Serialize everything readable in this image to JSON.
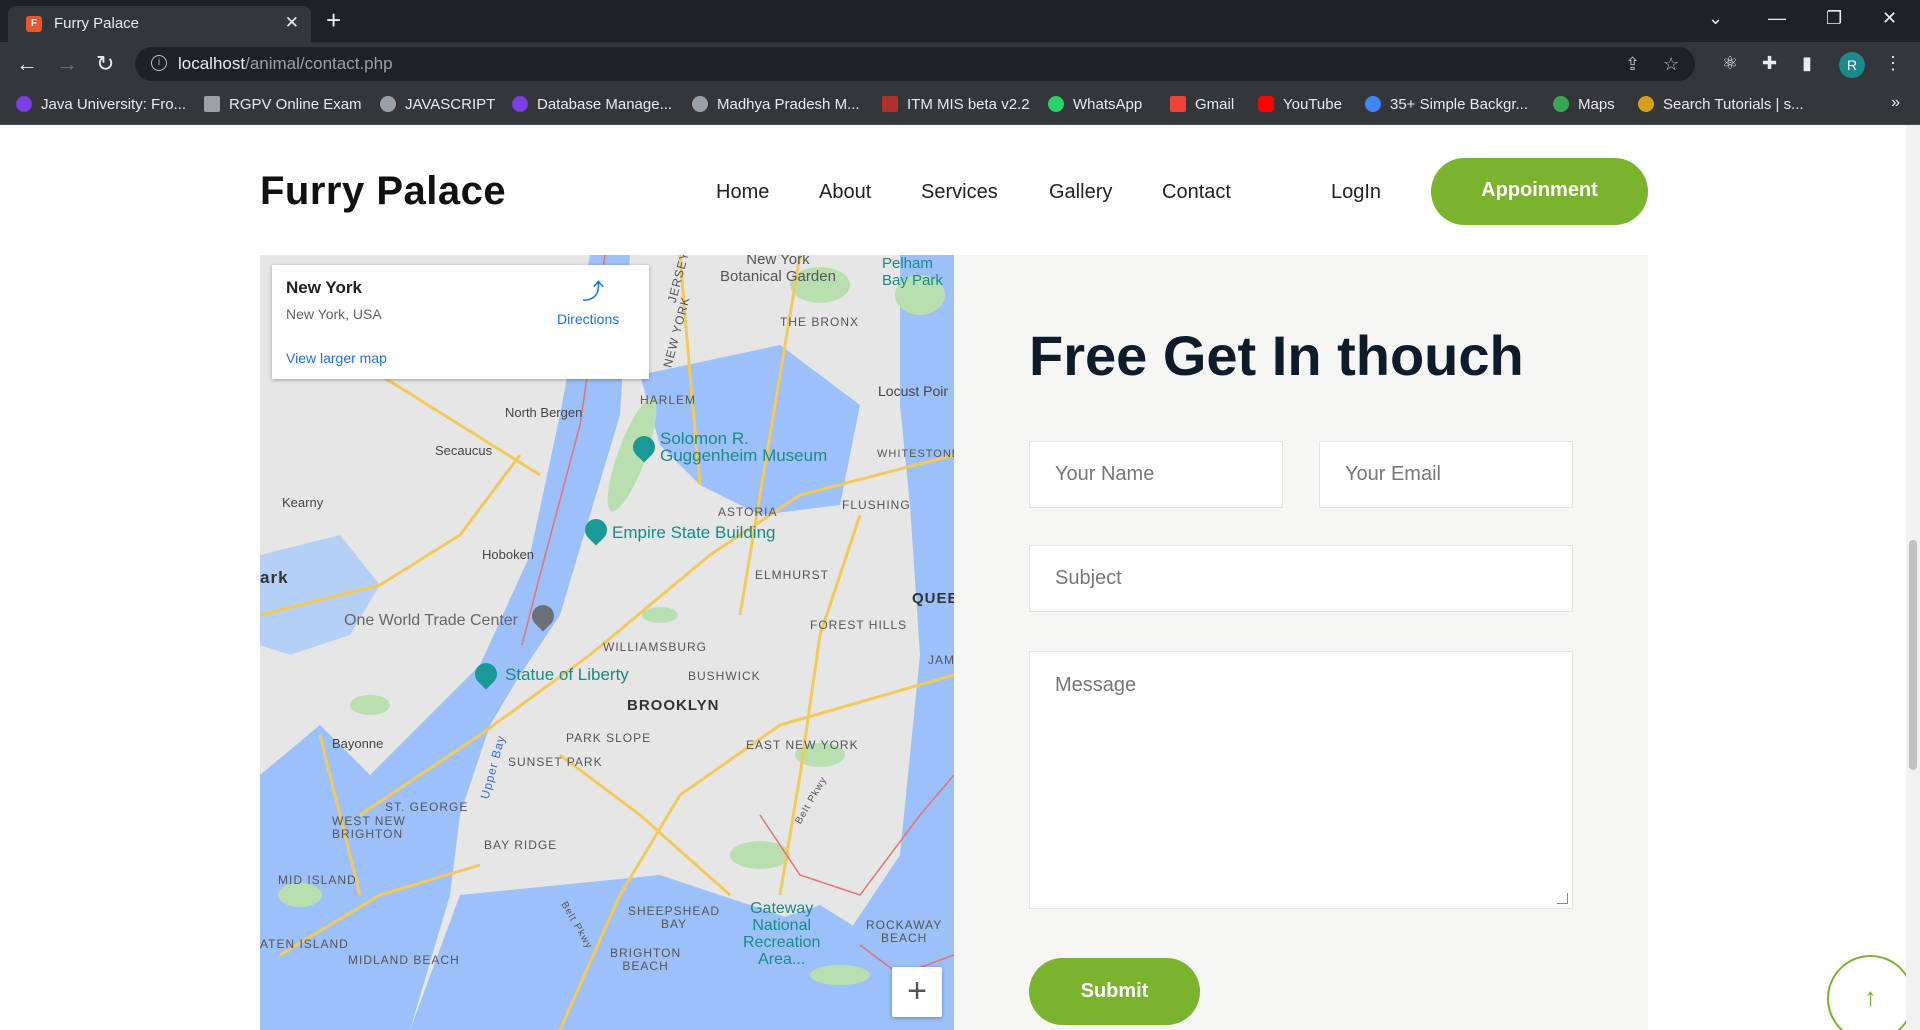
{
  "browser": {
    "tab_title": "Furry Palace",
    "url_host": "localhost",
    "url_path": "/animal/contact.php",
    "profile_initial": "R",
    "bookmarks": [
      {
        "label": "Java University: Fro...",
        "icon": "purple-circle-icon",
        "color": "#7b3fe4"
      },
      {
        "label": "RGPV Online Exam",
        "icon": "monitor-icon",
        "color": "#9aa0a6"
      },
      {
        "label": "JAVASCRIPT",
        "icon": "globe-icon",
        "color": "#9aa0a6"
      },
      {
        "label": "Database Manage...",
        "icon": "purple-circle-icon",
        "color": "#7b3fe4"
      },
      {
        "label": "Madhya Pradesh M...",
        "icon": "globe-icon",
        "color": "#9aa0a6"
      },
      {
        "label": "ITM MIS beta v2.2",
        "icon": "itm-icon",
        "color": "#b03030"
      },
      {
        "label": "WhatsApp",
        "icon": "whatsapp-icon",
        "color": "#25d366"
      },
      {
        "label": "Gmail",
        "icon": "gmail-icon",
        "color": "#ea4335"
      },
      {
        "label": "YouTube",
        "icon": "youtube-icon",
        "color": "#ff0000"
      },
      {
        "label": "35+ Simple Backgr...",
        "icon": "google-icon",
        "color": "#4285f4"
      },
      {
        "label": "Maps",
        "icon": "maps-icon",
        "color": "#34a853"
      },
      {
        "label": "Search Tutorials | s...",
        "icon": "tutorials-icon",
        "color": "#d4a017"
      }
    ]
  },
  "site": {
    "brand": "Furry Palace",
    "nav": [
      "Home",
      "About",
      "Services",
      "Gallery",
      "Contact"
    ],
    "login": "LogIn",
    "appointment": "Appoinment"
  },
  "map": {
    "card_title": "New York",
    "card_subtitle": "New York, USA",
    "card_link": "View larger map",
    "directions": "Directions",
    "labels": {
      "north_bergen": "North Bergen",
      "secaucus": "Secaucus",
      "kearny": "Kearny",
      "hoboken": "Hoboken",
      "park": "ark",
      "one_wtc": "One World Trade Center",
      "statue": "Statue of Liberty",
      "bayonne": "Bayonne",
      "west_new_brighton": "WEST NEW\nBRIGHTON",
      "st_george": "ST. GEORGE",
      "mid_island": "MID ISLAND",
      "staten_island": "ATEN ISLAND",
      "midland_beach": "MIDLAND BEACH",
      "harlem": "HARLEM",
      "guggenheim": "Solomon R.\nGuggenheim Museum",
      "empire": "Empire State Building",
      "astoria": "ASTORIA",
      "flushing": "FLUSHING",
      "elmhurst": "ELMHURST",
      "whitestone": "WHITESTONE",
      "queens": "QUEE",
      "forest_hills": "FOREST HILLS",
      "williamsburg": "WILLIAMSBURG",
      "bushwick": "BUSHWICK",
      "brooklyn": "BROOKLYN",
      "park_slope": "PARK SLOPE",
      "sunset_park": "SUNSET PARK",
      "east_new_york": "EAST NEW YORK",
      "bay_ridge": "BAY RIDGE",
      "sheepshead": "SHEEPSHEAD\nBAY",
      "brighton": "BRIGHTON\nBEACH",
      "gateway": "Gateway\nNational\nRecreation\nArea...",
      "rockaway": "ROCKAWAY\nBEACH",
      "bronx": "THE BRONX",
      "botanical": "New York\nBotanical Garden",
      "pelham": "Pelham\nBay Park",
      "locust": "Locust Poir",
      "upper_bay": "Upper Bay",
      "jersey": "JERSEY",
      "new_york_diag": "NEW YORK",
      "jam": "JAM",
      "belt_pkwy": "Belt Pkwy",
      "belt_pkwy2": "Belt Pkwy"
    }
  },
  "form": {
    "title": "Free Get In thouch",
    "name_placeholder": "Your Name",
    "email_placeholder": "Your Email",
    "subject_placeholder": "Subject",
    "message_placeholder": "Message",
    "submit": "Submit"
  }
}
